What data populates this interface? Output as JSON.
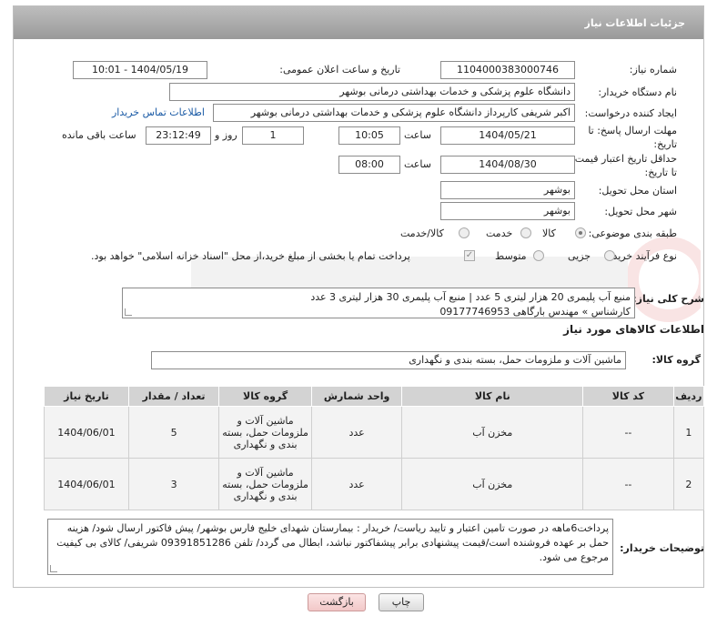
{
  "header": {
    "title": "جزئیات اطلاعات نیاز"
  },
  "fields": {
    "need_number_label": "شماره نیاز:",
    "need_number": "1104000383000746",
    "announce_label": "تاریخ و ساعت اعلان عمومی:",
    "announce_value": "1404/05/19 - 10:01",
    "buyer_org_label": "نام دستگاه خریدار:",
    "buyer_org": "دانشگاه علوم پزشکی و خدمات بهداشتی درمانی بوشهر",
    "creator_label": "ایجاد کننده درخواست:",
    "creator": "اکبر شریفی کارپرداز دانشگاه علوم پزشکی و خدمات بهداشتی درمانی بوشهر",
    "contact_link": "اطلاعات تماس خریدار",
    "deadline_label_1": "مهلت ارسال پاسخ: تا",
    "deadline_label_2": "تاریخ:",
    "deadline_date": "1404/05/21",
    "time_label": "ساعت",
    "deadline_time": "10:05",
    "days_value": "1",
    "days_label": "روز و",
    "remaining_time": "23:12:49",
    "remaining_label": "ساعت باقی مانده",
    "validity_label_1": "حداقل تاریخ اعتبار قیمت:",
    "validity_label_2": "تا تاریخ:",
    "validity_date": "1404/08/30",
    "validity_time": "08:00",
    "province_label": "استان محل تحویل:",
    "province": "بوشهر",
    "city_label": "شهر محل تحویل:",
    "city": "بوشهر",
    "category_label": "طبقه بندی موضوعی:",
    "category_options": [
      "کالا",
      "خدمت",
      "کالا/خدمت"
    ],
    "category_selected": "کالا",
    "process_label": "نوع فرآیند خرید :",
    "process_options": [
      "جزیی",
      "متوسط"
    ],
    "process_selected": "جزیی",
    "payment_note": "پرداخت تمام یا بخشی از مبلغ خرید،از محل \"اسناد خزانه اسلامی\" خواهد بود."
  },
  "description": {
    "label": "شرح کلی نیاز:",
    "line1": "منبع آب پلیمری 20 هزار لیتری 5 عدد | منبع آب پلیمری 30 هزار لیتری 3 عدد",
    "line2": "کارشناس » مهندس بارگاهی 09177746953"
  },
  "goods_section": {
    "title": "اطلاعات کالاهای مورد نیاز",
    "group_label": "گروه کالا:",
    "group_value": "ماشین آلات و ملزومات حمل، بسته بندی و نگهداری"
  },
  "table": {
    "headers": [
      "ردیف",
      "کد کالا",
      "نام کالا",
      "واحد شمارش",
      "گروه کالا",
      "تعداد / مقدار",
      "تاریخ نیاز"
    ],
    "rows": [
      {
        "row": "1",
        "code": "--",
        "name": "مخزن آب",
        "unit": "عدد",
        "group": "ماشین آلات و ملزومات حمل، بسته بندی و نگهداری",
        "qty": "5",
        "date": "1404/06/01"
      },
      {
        "row": "2",
        "code": "--",
        "name": "مخزن آب",
        "unit": "عدد",
        "group": "ماشین آلات و ملزومات حمل، بسته بندی و نگهداری",
        "qty": "3",
        "date": "1404/06/01"
      }
    ]
  },
  "buyer_notes": {
    "label": "توضیحات خریدار:",
    "text": "پرداخت6ماهه در صورت تامین اعتبار و تایید ریاست/ خریدار : بیمارستان شهدای خلیج فارس بوشهر/ پیش فاکتور ارسال شود/ هزینه حمل بر عهده فروشنده است/قیمت پیشنهادی برابر پیشفاکتور نباشد، ابطال می گردد/ تلفن 09391851286 شریفی/ کالای بی کیفیت مرجوع می شود."
  },
  "buttons": {
    "print": "چاپ",
    "back": "بازگشت"
  },
  "colors": {
    "link": "#1a5aa5",
    "header_bg": "#a8a8a8",
    "table_header": "#d3d3d3"
  }
}
